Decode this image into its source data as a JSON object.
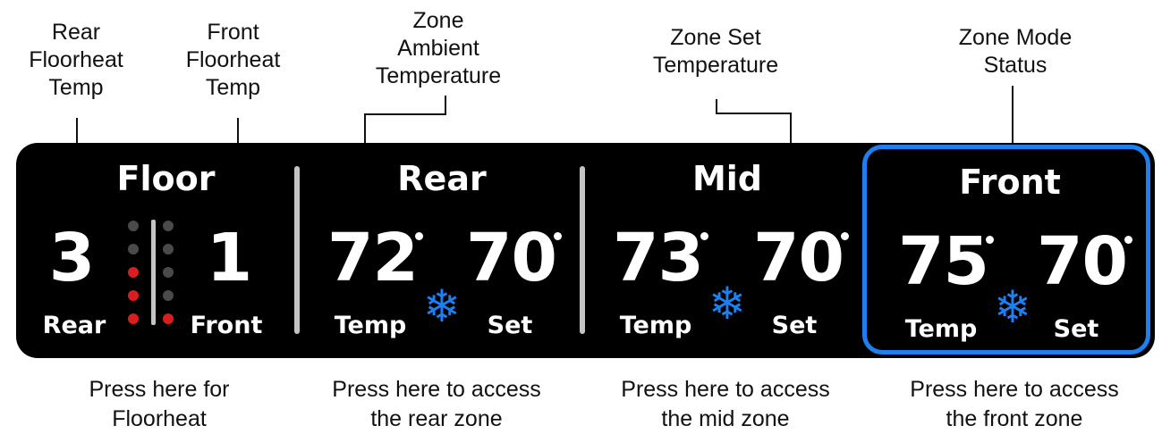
{
  "callouts": {
    "rear_floorheat_temp": "Rear\nFloorheat\nTemp",
    "front_floorheat_temp": "Front\nFloorheat\nTemp",
    "zone_ambient_temperature": "Zone\nAmbient\nTemperature",
    "zone_set_temperature": "Zone Set\nTemperature",
    "zone_mode_status": "Zone Mode\nStatus"
  },
  "floor": {
    "title": "Floor",
    "rear_value": "3",
    "front_value": "1",
    "rear_label": "Rear",
    "front_label": "Front",
    "rear_level": 3,
    "front_level": 1,
    "max_level": 5
  },
  "zones": {
    "rear": {
      "title": "Rear",
      "temp": "72",
      "set": "70",
      "temp_label": "Temp",
      "set_label": "Set",
      "mode_icon": "snowflake-icon"
    },
    "mid": {
      "title": "Mid",
      "temp": "73",
      "set": "70",
      "temp_label": "Temp",
      "set_label": "Set",
      "mode_icon": "snowflake-icon"
    },
    "front": {
      "title": "Front",
      "temp": "75",
      "set": "70",
      "temp_label": "Temp",
      "set_label": "Set",
      "mode_icon": "snowflake-icon",
      "selected": true
    }
  },
  "press_labels": {
    "floor": "Press here for\nFloorheat",
    "rear": "Press here to access\nthe rear zone",
    "mid": "Press here to access\nthe mid zone",
    "front": "Press here to access\nthe front zone"
  },
  "colors": {
    "panel": "#000000",
    "accent_blue": "#1e7ff0",
    "dot_active": "#d81e1e",
    "dot_inactive": "#4a4a4a",
    "divider": "#c4c4c4"
  },
  "glyphs": {
    "snowflake": "❄"
  }
}
